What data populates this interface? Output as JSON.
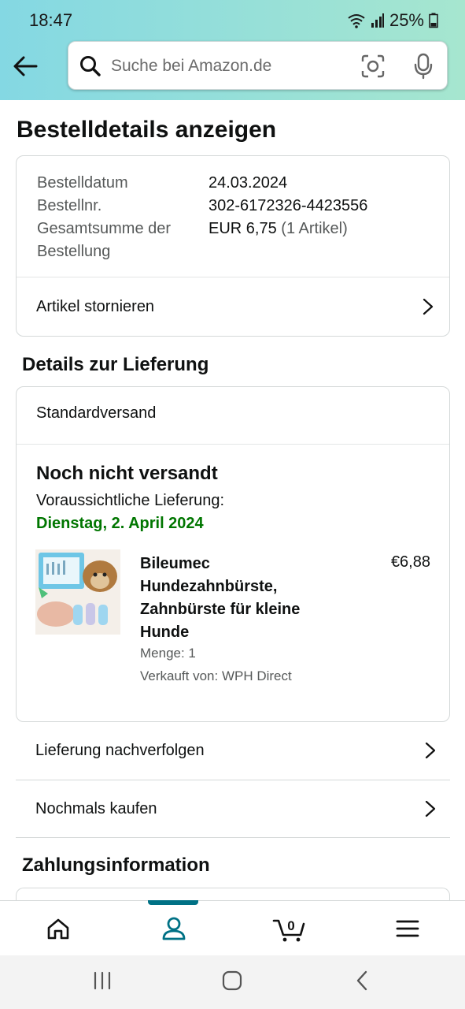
{
  "status_bar": {
    "time": "18:47",
    "battery": "25%"
  },
  "search": {
    "placeholder": "Suche bei Amazon.de"
  },
  "page_title": "Bestelldetails anzeigen",
  "summary": {
    "order_date_label": "Bestelldatum",
    "order_date": "24.03.2024",
    "order_number_label": "Bestellnr.",
    "order_number": "302-6172326-4423556",
    "total_label_line1": "Gesamtsumme der",
    "total_label_line2": "Bestellung",
    "total_value": "EUR 6,75",
    "total_items": "(1 Artikel)",
    "cancel_label": "Artikel stornieren"
  },
  "delivery": {
    "section_title": "Details zur Lieferung",
    "shipping_method": "Standardversand",
    "status": "Noch nicht versandt",
    "eta_label": "Voraussichtliche Lieferung:",
    "eta_date": "Dienstag, 2. April 2024",
    "product": {
      "name": "Bileumec Hundezahnbürste, Zahnbürste für kleine Hunde",
      "price": "€6,88",
      "quantity": "Menge: 1",
      "seller": "Verkauft von: WPH Direct",
      "image_icon": "product-image"
    }
  },
  "actions": {
    "track": "Lieferung nachverfolgen",
    "buy_again": "Nochmals kaufen"
  },
  "payment": {
    "section_title": "Zahlungsinformation"
  },
  "bottom_nav": {
    "items": [
      "home-icon",
      "account-icon",
      "cart-icon",
      "menu-icon"
    ],
    "cart_count": "0",
    "active": "account-icon",
    "accent": "#007185"
  },
  "colors": {
    "eta_green": "#007600",
    "header_left": "#84d8e3",
    "header_right": "#a6e6cf"
  }
}
